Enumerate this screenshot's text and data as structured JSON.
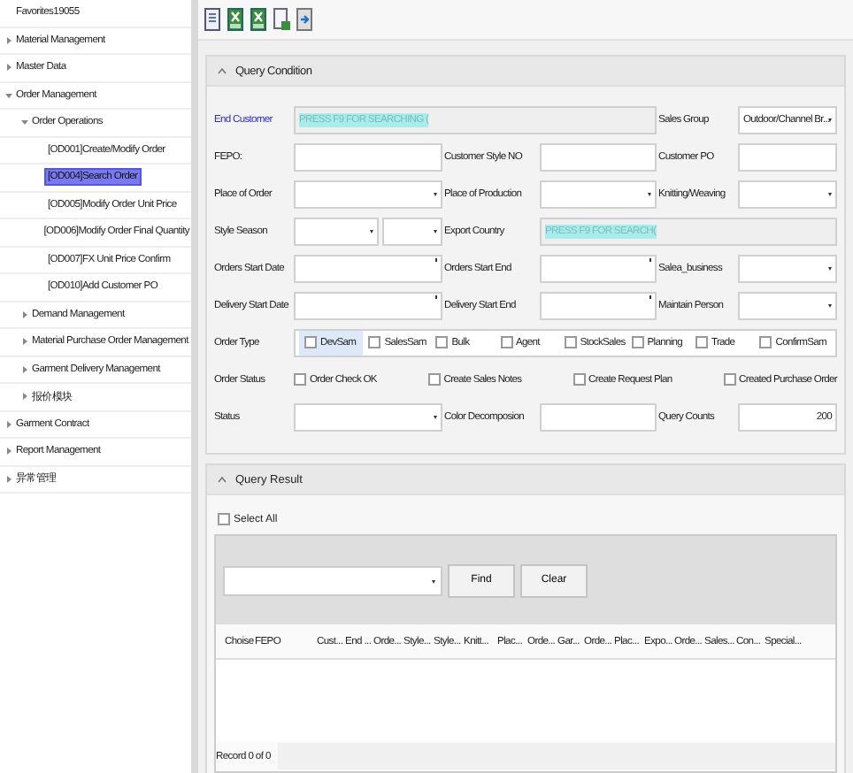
{
  "sidebar": {
    "items": [
      {
        "label": "Favorites19055",
        "selected": false
      },
      {
        "label": "Material Management",
        "expanded": false,
        "selected": false
      },
      {
        "label": "Master Data",
        "expanded": false,
        "selected": false
      },
      {
        "label": "Order Management",
        "expanded": true,
        "selected": false,
        "children": [
          {
            "label": "Order Operations",
            "expanded": true,
            "selected": false,
            "children": [
              {
                "label": "[OD001]Create/Modify Order",
                "selected": false
              },
              {
                "label": "[OD004]Search Order",
                "selected": true
              },
              {
                "label": "[OD005]Modify Order Unit Price",
                "selected": false
              },
              {
                "label": "[OD006]Modify Order Final Quantity",
                "selected": false
              },
              {
                "label": "[OD007]FX Unit Price Confirm",
                "selected": false
              },
              {
                "label": "[OD010]Add Customer PO",
                "selected": false
              }
            ]
          },
          {
            "label": "Demand Management",
            "expanded": false,
            "selected": false
          },
          {
            "label": "Material Purchase Order Management",
            "expanded": false,
            "selected": false
          },
          {
            "label": "Garment Delivery Management",
            "expanded": false,
            "selected": false
          },
          {
            "label": "报价模块",
            "expanded": false,
            "selected": false
          }
        ]
      },
      {
        "label": "Garment Contract",
        "expanded": false,
        "selected": false
      },
      {
        "label": "Report Management",
        "expanded": false,
        "selected": false
      },
      {
        "label": "异常管理",
        "expanded": false,
        "selected": false
      }
    ]
  },
  "toolbar": {
    "buttons": [
      {
        "kind": "document"
      },
      {
        "kind": "excel"
      },
      {
        "kind": "excel"
      },
      {
        "kind": "sheet"
      },
      {
        "kind": "export"
      }
    ]
  },
  "query_condition": {
    "title": "Query Condition",
    "expanded": true,
    "rows": [
      [
        {
          "kind": "link-label",
          "text": "End Customer"
        },
        {
          "kind": "search",
          "value": "PRESS F9 FOR SEARCHING ("
        },
        "",
        "",
        {
          "kind": "label",
          "text": "Sales Group"
        },
        {
          "kind": "select",
          "value": "Outdoor/Channel Br..."
        }
      ],
      [
        {
          "kind": "label",
          "text": "FEPO:"
        },
        {
          "kind": "input"
        },
        {
          "kind": "label",
          "text": "Customer Style NO"
        },
        {
          "kind": "input"
        },
        {
          "kind": "label",
          "text": "Customer PO"
        },
        {
          "kind": "input"
        }
      ],
      [
        {
          "kind": "label",
          "text": "Place of Order"
        },
        {
          "kind": "select"
        },
        {
          "kind": "label",
          "text": "Place of Production"
        },
        {
          "kind": "select"
        },
        {
          "kind": "label",
          "text": "Knitting/Weaving"
        },
        {
          "kind": "select"
        }
      ],
      [
        {
          "kind": "label",
          "text": "Style Season"
        },
        {
          "kind": "select-pair"
        },
        {
          "kind": "label",
          "text": "Export Country"
        },
        {
          "kind": "search",
          "value": "PRESS F9 FOR SEARCH("
        },
        "",
        ""
      ],
      [
        {
          "kind": "label",
          "text": "Orders Start Date"
        },
        {
          "kind": "date"
        },
        {
          "kind": "label",
          "text": "Orders Start End"
        },
        {
          "kind": "date"
        },
        {
          "kind": "label",
          "text": "Salea_business"
        },
        {
          "kind": "select"
        }
      ],
      [
        {
          "kind": "label",
          "text": "Delivery Start Date"
        },
        {
          "kind": "date"
        },
        {
          "kind": "label",
          "text": "Delivery Start End"
        },
        {
          "kind": "date"
        },
        {
          "kind": "label",
          "text": "Maintain Person"
        },
        {
          "kind": "select"
        }
      ],
      [
        {
          "kind": "label",
          "text": "Order Type"
        },
        {
          "kind": "checkgroup",
          "options": [
            {
              "label": "DevSam",
              "checked": false,
              "selected": true
            },
            {
              "label": "SalesSam",
              "checked": false,
              "selected": false
            },
            {
              "label": "Bulk",
              "checked": false,
              "selected": false
            },
            {
              "label": "Agent",
              "checked": false,
              "selected": false
            },
            {
              "label": "StockSales",
              "checked": false,
              "selected": false
            },
            {
              "label": "Planning",
              "checked": false,
              "selected": false
            },
            {
              "label": "Trade",
              "checked": false,
              "selected": false
            },
            {
              "label": "ConfirmSam",
              "checked": false,
              "selected": false
            }
          ]
        },
        "",
        "",
        "",
        ""
      ],
      [
        {
          "kind": "label",
          "text": "Order Status"
        },
        {
          "kind": "checkrow",
          "options": [
            {
              "label": "Order Check OK",
              "checked": false
            },
            {
              "label": "Create Sales Notes",
              "checked": false
            },
            {
              "label": "Create Request Plan",
              "checked": false
            },
            {
              "label": "Created Purchase Order",
              "checked": false
            }
          ]
        },
        "",
        "",
        "",
        ""
      ],
      [
        {
          "kind": "label",
          "text": "Status"
        },
        {
          "kind": "select"
        },
        {
          "kind": "label",
          "text": "Color Decomposion"
        },
        {
          "kind": "input"
        },
        {
          "kind": "label",
          "text": "Query Counts"
        },
        {
          "kind": "number",
          "value": "200"
        }
      ]
    ]
  },
  "query_result": {
    "title": "Query Result",
    "expanded": true,
    "select_all": {
      "label": "Select All",
      "checked": false
    },
    "buttons": [
      "Find",
      "Clear"
    ],
    "columns": [
      "Choise",
      "FEPO",
      "Cust...",
      "End ...",
      "Orde...",
      "Style...",
      "Style...",
      "Knitt...",
      "Plac...",
      "Orde...",
      "Gar...",
      "Orde...",
      "Plac...",
      "Expo...",
      "Orde...",
      "Sales...",
      "Con...",
      "Special..."
    ],
    "footer": "Record 0 of 0"
  }
}
